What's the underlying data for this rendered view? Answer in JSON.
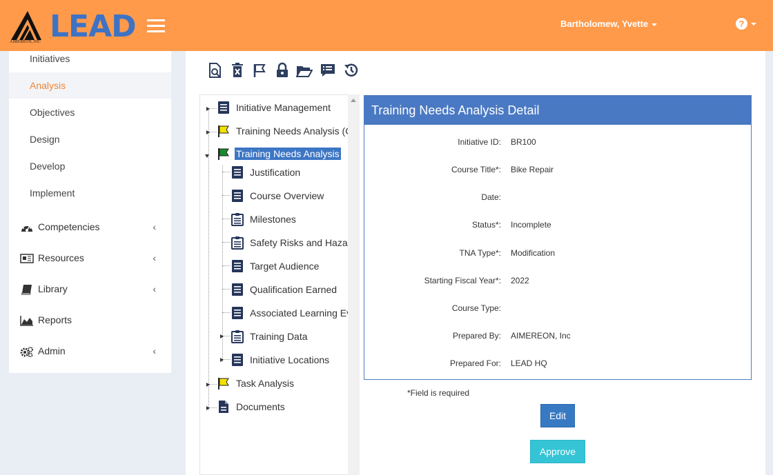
{
  "header": {
    "logo_text": "LEAD",
    "logo_subtext": "AIMEREON, INC",
    "user_name": "Bartholomew, Yvette",
    "help_icon": "question-circle-icon",
    "colors": {
      "header_bg": "#ff9a4b",
      "accent": "#3e73c4"
    }
  },
  "sidebar": {
    "sub_items": [
      {
        "label": "Initiatives",
        "active": false
      },
      {
        "label": "Analysis",
        "active": true
      },
      {
        "label": "Objectives",
        "active": false
      },
      {
        "label": "Design",
        "active": false
      },
      {
        "label": "Develop",
        "active": false
      },
      {
        "label": "Implement",
        "active": false
      }
    ],
    "main_items": [
      {
        "label": "Competencies",
        "icon": "dashboard-icon",
        "has_children": true
      },
      {
        "label": "Resources",
        "icon": "newspaper-icon",
        "has_children": true
      },
      {
        "label": "Library",
        "icon": "book-icon",
        "has_children": true
      },
      {
        "label": "Reports",
        "icon": "area-chart-icon",
        "has_children": false
      },
      {
        "label": "Admin",
        "icon": "cogs-icon",
        "has_children": true
      }
    ]
  },
  "toolbar": {
    "icons": [
      "file-search-icon",
      "trash-icon",
      "flag-icon",
      "lock-icon",
      "folder-open-icon",
      "list-comment-icon",
      "history-icon"
    ]
  },
  "tree": {
    "nodes": [
      {
        "label": "Initiative Management",
        "icon": "document-list-icon"
      },
      {
        "label": "Training Needs Analysis (C",
        "icon": "yellow-flag-icon"
      },
      {
        "label": "Training Needs Analysis",
        "icon": "green-flag-icon",
        "selected": true
      },
      {
        "label": "Justification",
        "icon": "document-list-icon"
      },
      {
        "label": "Course Overview",
        "icon": "document-list-icon"
      },
      {
        "label": "Milestones",
        "icon": "clipboard-icon"
      },
      {
        "label": "Safety Risks and Hazar",
        "icon": "clipboard-icon"
      },
      {
        "label": "Target Audience",
        "icon": "document-list-icon"
      },
      {
        "label": "Qualification Earned",
        "icon": "document-list-icon"
      },
      {
        "label": "Associated Learning Ev",
        "icon": "document-list-icon"
      },
      {
        "label": "Training Data",
        "icon": "clipboard-icon"
      },
      {
        "label": "Initiative Locations",
        "icon": "document-list-icon"
      },
      {
        "label": "Task Analysis",
        "icon": "yellow-flag-icon"
      },
      {
        "label": "Documents",
        "icon": "file-icon"
      }
    ]
  },
  "detail": {
    "title": "Training Needs Analysis Detail",
    "fields": [
      {
        "label": "Initiative ID:",
        "value": "BR100"
      },
      {
        "label": "Course Title*:",
        "value": "Bike Repair"
      },
      {
        "label": "Date:",
        "value": ""
      },
      {
        "label": "Status*:",
        "value": "Incomplete"
      },
      {
        "label": "TNA Type*:",
        "value": "Modification"
      },
      {
        "label": "Starting Fiscal Year*:",
        "value": "2022"
      },
      {
        "label": "Course Type:",
        "value": ""
      },
      {
        "label": "Prepared By:",
        "value": "AIMEREON, Inc"
      },
      {
        "label": "Prepared For:",
        "value": "LEAD HQ"
      }
    ],
    "required_note": "*Field is required",
    "edit_label": "Edit",
    "approve_label": "Approve"
  }
}
